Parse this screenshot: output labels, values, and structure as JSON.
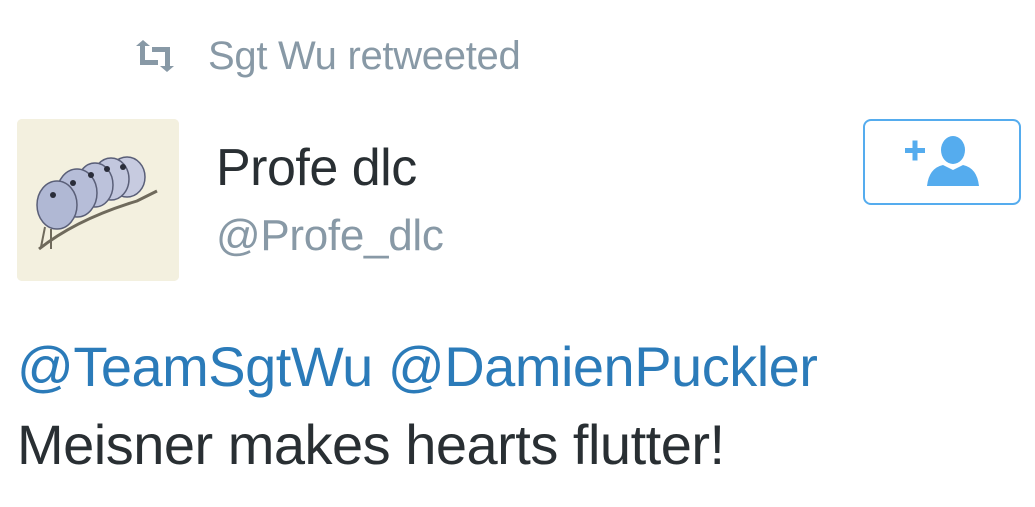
{
  "retweet": {
    "icon": "retweet-icon",
    "text": "Sgt Wu retweeted"
  },
  "author": {
    "avatar": "avatar-birds-illustration",
    "display_name": "Profe dlc",
    "handle": "@Profe_dlc"
  },
  "follow_button": {
    "icon": "add-user-icon"
  },
  "tweet": {
    "mention_1": "@TeamSgtWu",
    "mention_2": "@DamienPuckler",
    "body": "Meisner makes hearts flutter!"
  },
  "colors": {
    "accent": "#55acee",
    "link": "#2b7bb9",
    "muted": "#8899a6",
    "text": "#292f33"
  }
}
